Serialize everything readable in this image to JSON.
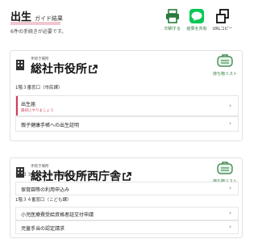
{
  "header": {
    "title": "出生",
    "subtitle": "ガイド結果",
    "count_text": "6件の手続きが必要です。",
    "actions": [
      {
        "label": "印刷する",
        "icon": "printer-icon"
      },
      {
        "label": "結果を共有",
        "icon": "line-share-icon"
      },
      {
        "label": "URLコピー",
        "icon": "copy-icon"
      }
    ]
  },
  "offices": [
    {
      "small": "手続き場所",
      "name": "総社市役所",
      "bag_label": "持ち物リスト",
      "sections": [
        {
          "label": "1階３番窓口（市民課）",
          "items": [
            {
              "text": "出生届",
              "note": "最初にやりましょう"
            },
            {
              "text": "親子健康手帳への出生証明",
              "note": ""
            }
          ]
        }
      ]
    },
    {
      "small": "手続き場所",
      "name": "総社市役所西庁舎",
      "bag_label": "持ち物リスト",
      "sections": [
        {
          "label": "1階３３番窓口（こども夢づくり課）",
          "items": [
            {
              "text": "保育園等の利用申込み",
              "note": ""
            }
          ]
        },
        {
          "label": "1階３４番窓口（こども課）",
          "items": [
            {
              "text": "小児医療費受給資格者証交付申請",
              "note": ""
            },
            {
              "text": "児童手当の認定請求",
              "note": ""
            }
          ]
        }
      ]
    }
  ],
  "colors": {
    "accent": "#d23c5a",
    "green": "#2a7a3b",
    "line_green": "#06c755"
  }
}
